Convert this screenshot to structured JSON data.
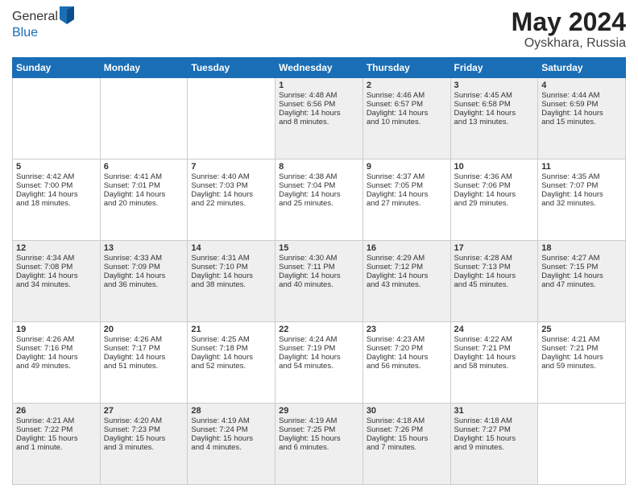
{
  "header": {
    "logo_general": "General",
    "logo_blue": "Blue",
    "month_year": "May 2024",
    "location": "Oyskhara, Russia"
  },
  "days_of_week": [
    "Sunday",
    "Monday",
    "Tuesday",
    "Wednesday",
    "Thursday",
    "Friday",
    "Saturday"
  ],
  "weeks": [
    [
      {
        "day": "",
        "content": ""
      },
      {
        "day": "",
        "content": ""
      },
      {
        "day": "",
        "content": ""
      },
      {
        "day": "1",
        "content": "Sunrise: 4:48 AM\nSunset: 6:56 PM\nDaylight: 14 hours\nand 8 minutes."
      },
      {
        "day": "2",
        "content": "Sunrise: 4:46 AM\nSunset: 6:57 PM\nDaylight: 14 hours\nand 10 minutes."
      },
      {
        "day": "3",
        "content": "Sunrise: 4:45 AM\nSunset: 6:58 PM\nDaylight: 14 hours\nand 13 minutes."
      },
      {
        "day": "4",
        "content": "Sunrise: 4:44 AM\nSunset: 6:59 PM\nDaylight: 14 hours\nand 15 minutes."
      }
    ],
    [
      {
        "day": "5",
        "content": "Sunrise: 4:42 AM\nSunset: 7:00 PM\nDaylight: 14 hours\nand 18 minutes."
      },
      {
        "day": "6",
        "content": "Sunrise: 4:41 AM\nSunset: 7:01 PM\nDaylight: 14 hours\nand 20 minutes."
      },
      {
        "day": "7",
        "content": "Sunrise: 4:40 AM\nSunset: 7:03 PM\nDaylight: 14 hours\nand 22 minutes."
      },
      {
        "day": "8",
        "content": "Sunrise: 4:38 AM\nSunset: 7:04 PM\nDaylight: 14 hours\nand 25 minutes."
      },
      {
        "day": "9",
        "content": "Sunrise: 4:37 AM\nSunset: 7:05 PM\nDaylight: 14 hours\nand 27 minutes."
      },
      {
        "day": "10",
        "content": "Sunrise: 4:36 AM\nSunset: 7:06 PM\nDaylight: 14 hours\nand 29 minutes."
      },
      {
        "day": "11",
        "content": "Sunrise: 4:35 AM\nSunset: 7:07 PM\nDaylight: 14 hours\nand 32 minutes."
      }
    ],
    [
      {
        "day": "12",
        "content": "Sunrise: 4:34 AM\nSunset: 7:08 PM\nDaylight: 14 hours\nand 34 minutes."
      },
      {
        "day": "13",
        "content": "Sunrise: 4:33 AM\nSunset: 7:09 PM\nDaylight: 14 hours\nand 36 minutes."
      },
      {
        "day": "14",
        "content": "Sunrise: 4:31 AM\nSunset: 7:10 PM\nDaylight: 14 hours\nand 38 minutes."
      },
      {
        "day": "15",
        "content": "Sunrise: 4:30 AM\nSunset: 7:11 PM\nDaylight: 14 hours\nand 40 minutes."
      },
      {
        "day": "16",
        "content": "Sunrise: 4:29 AM\nSunset: 7:12 PM\nDaylight: 14 hours\nand 43 minutes."
      },
      {
        "day": "17",
        "content": "Sunrise: 4:28 AM\nSunset: 7:13 PM\nDaylight: 14 hours\nand 45 minutes."
      },
      {
        "day": "18",
        "content": "Sunrise: 4:27 AM\nSunset: 7:15 PM\nDaylight: 14 hours\nand 47 minutes."
      }
    ],
    [
      {
        "day": "19",
        "content": "Sunrise: 4:26 AM\nSunset: 7:16 PM\nDaylight: 14 hours\nand 49 minutes."
      },
      {
        "day": "20",
        "content": "Sunrise: 4:26 AM\nSunset: 7:17 PM\nDaylight: 14 hours\nand 51 minutes."
      },
      {
        "day": "21",
        "content": "Sunrise: 4:25 AM\nSunset: 7:18 PM\nDaylight: 14 hours\nand 52 minutes."
      },
      {
        "day": "22",
        "content": "Sunrise: 4:24 AM\nSunset: 7:19 PM\nDaylight: 14 hours\nand 54 minutes."
      },
      {
        "day": "23",
        "content": "Sunrise: 4:23 AM\nSunset: 7:20 PM\nDaylight: 14 hours\nand 56 minutes."
      },
      {
        "day": "24",
        "content": "Sunrise: 4:22 AM\nSunset: 7:21 PM\nDaylight: 14 hours\nand 58 minutes."
      },
      {
        "day": "25",
        "content": "Sunrise: 4:21 AM\nSunset: 7:21 PM\nDaylight: 14 hours\nand 59 minutes."
      }
    ],
    [
      {
        "day": "26",
        "content": "Sunrise: 4:21 AM\nSunset: 7:22 PM\nDaylight: 15 hours\nand 1 minute."
      },
      {
        "day": "27",
        "content": "Sunrise: 4:20 AM\nSunset: 7:23 PM\nDaylight: 15 hours\nand 3 minutes."
      },
      {
        "day": "28",
        "content": "Sunrise: 4:19 AM\nSunset: 7:24 PM\nDaylight: 15 hours\nand 4 minutes."
      },
      {
        "day": "29",
        "content": "Sunrise: 4:19 AM\nSunset: 7:25 PM\nDaylight: 15 hours\nand 6 minutes."
      },
      {
        "day": "30",
        "content": "Sunrise: 4:18 AM\nSunset: 7:26 PM\nDaylight: 15 hours\nand 7 minutes."
      },
      {
        "day": "31",
        "content": "Sunrise: 4:18 AM\nSunset: 7:27 PM\nDaylight: 15 hours\nand 9 minutes."
      },
      {
        "day": "",
        "content": ""
      }
    ]
  ]
}
